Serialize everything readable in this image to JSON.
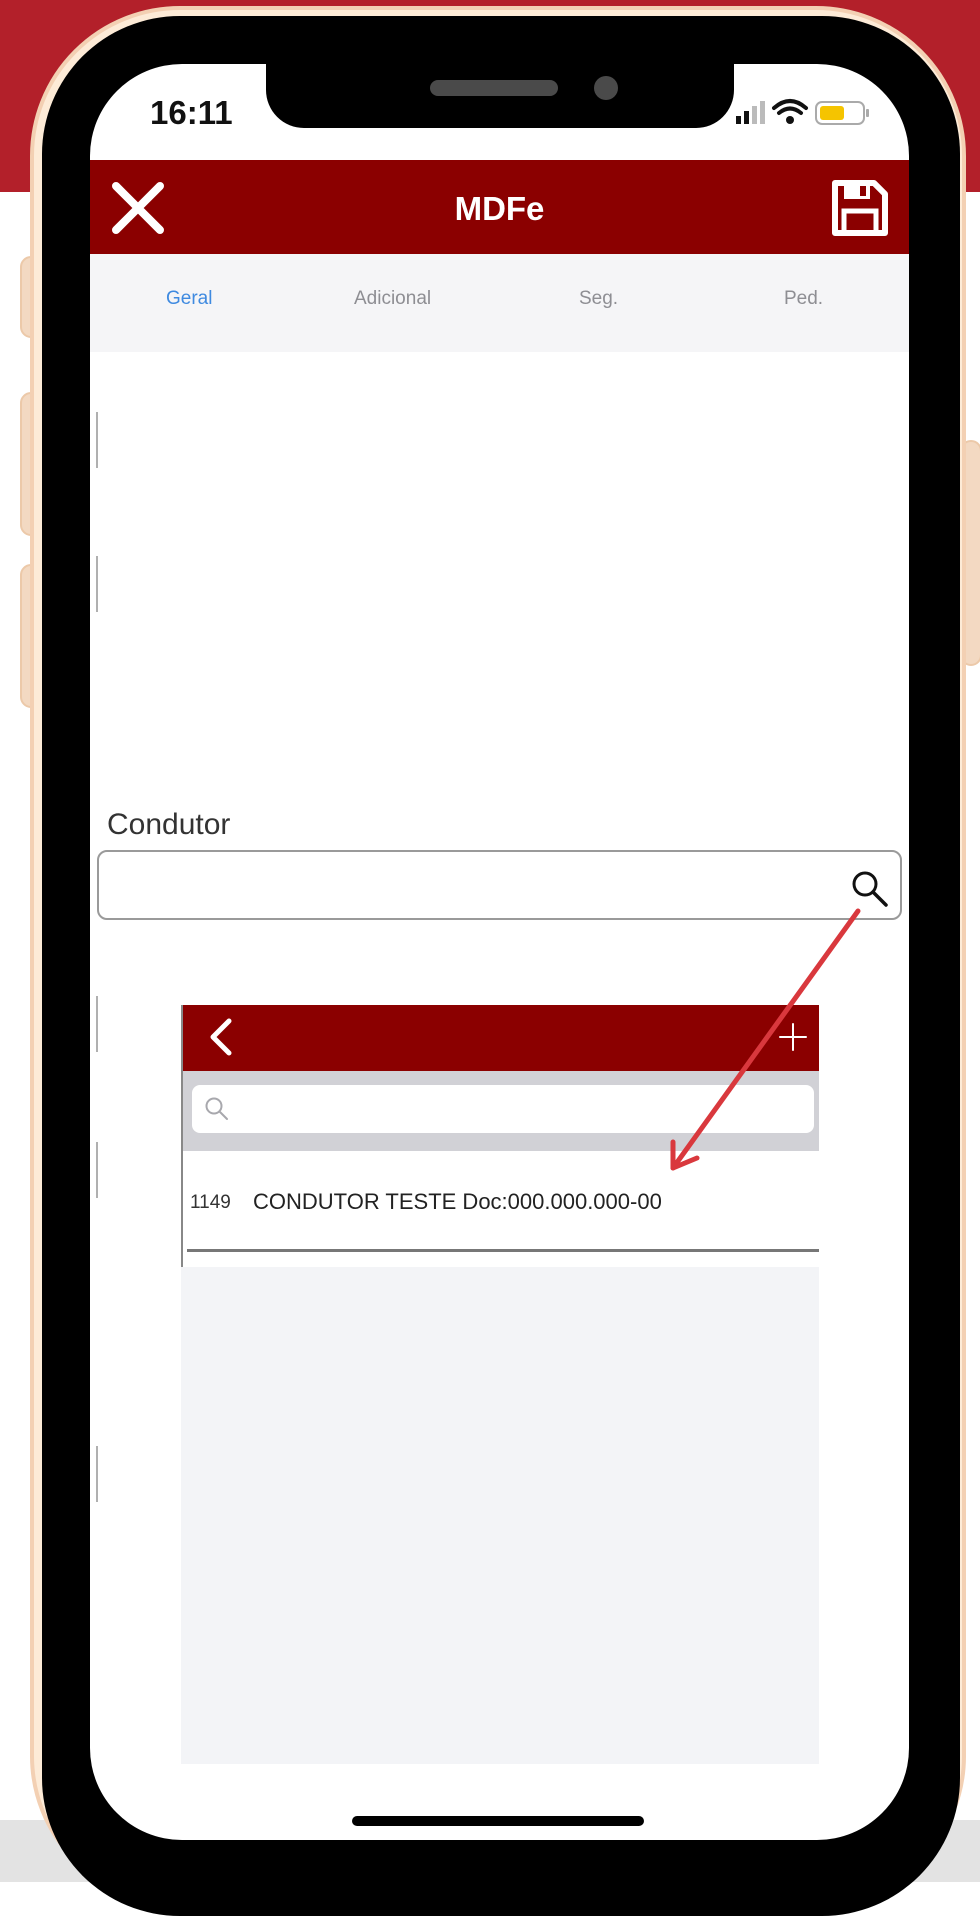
{
  "status_bar": {
    "time": "16:11"
  },
  "header": {
    "title": "MDFe"
  },
  "tabs": [
    {
      "label": "Geral",
      "active": true
    },
    {
      "label": "Adicional",
      "active": false
    },
    {
      "label": "Seg.",
      "active": false
    },
    {
      "label": "Ped.",
      "active": false
    }
  ],
  "condutor": {
    "label": "Condutor",
    "value": ""
  },
  "picker": {
    "search_value": "",
    "rows": [
      {
        "id": "1149",
        "text": "CONDUTOR TESTE Doc:000.000.000-00"
      }
    ]
  },
  "icons": {
    "close": "close-icon",
    "save": "save-icon",
    "search": "search-icon",
    "back": "chevron-left-icon",
    "add": "plus-icon"
  },
  "colors": {
    "brand": "#8b0000",
    "page_band": "#b3202a",
    "active_tab": "#3f8ae0",
    "annotation_arrow": "#d9383d"
  }
}
